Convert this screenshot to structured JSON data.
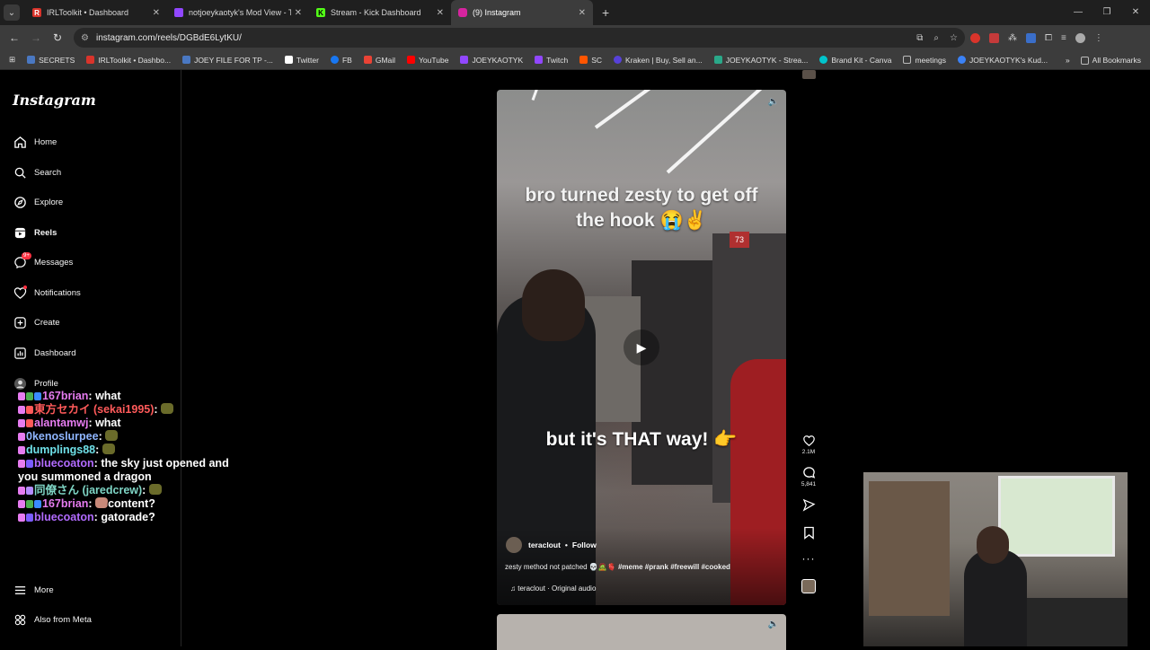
{
  "browser": {
    "tabs": [
      {
        "title": "IRLToolkit • Dashboard",
        "color": "#d9342b",
        "glyph": "R"
      },
      {
        "title": "notjoeykaotyk's Mod View - Tw",
        "color": "#9147ff",
        "glyph": ""
      },
      {
        "title": "Stream - Kick Dashboard",
        "color": "#53fc18",
        "glyph": "K"
      },
      {
        "title": "(9) Instagram",
        "color": "#d6249f",
        "glyph": ""
      }
    ],
    "url": "instagram.com/reels/DGBdE6LytKU/",
    "bookmarks": [
      {
        "label": "SECRETS",
        "color": "#4a78c2"
      },
      {
        "label": "IRLToolkit • Dashbo...",
        "color": "#d9342b"
      },
      {
        "label": "JOEY FILE FOR TP -...",
        "color": "#4a78c2"
      },
      {
        "label": "Twitter",
        "color": "#ffffff"
      },
      {
        "label": "FB",
        "color": "#1877f2"
      },
      {
        "label": "GMail",
        "color": "#ea4335"
      },
      {
        "label": "YouTube",
        "color": "#ff0000"
      },
      {
        "label": "JOEYKAOTYK",
        "color": "#9147ff"
      },
      {
        "label": "Twitch",
        "color": "#9147ff"
      },
      {
        "label": "SC",
        "color": "#ff5500"
      },
      {
        "label": "Kraken | Buy, Sell an...",
        "color": "#5741d9"
      },
      {
        "label": "JOEYKAOTYK - Strea...",
        "color": "#2aa889"
      },
      {
        "label": "Brand Kit - Canva",
        "color": "#00c4cc"
      },
      {
        "label": "meetings",
        "color": "#888888"
      },
      {
        "label": "JOEYKAOTYK's Kud...",
        "color": "#3b82f6"
      }
    ],
    "all_bookmarks": "All Bookmarks"
  },
  "sidebar": {
    "logo": "Instagram",
    "items": [
      {
        "label": "Home",
        "icon": "home-icon"
      },
      {
        "label": "Search",
        "icon": "search-icon"
      },
      {
        "label": "Explore",
        "icon": "compass-icon"
      },
      {
        "label": "Reels",
        "icon": "reels-icon"
      },
      {
        "label": "Messages",
        "icon": "messenger-icon",
        "badge": "9+"
      },
      {
        "label": "Notifications",
        "icon": "heart-icon"
      },
      {
        "label": "Create",
        "icon": "plus-square-icon"
      },
      {
        "label": "Dashboard",
        "icon": "chart-icon"
      },
      {
        "label": "Profile",
        "icon": "avatar-icon"
      }
    ],
    "more": "More",
    "also_from_meta": "Also from Meta"
  },
  "chat": [
    {
      "user": "167brian",
      "cls": "u-pink",
      "msg": "what",
      "emote": false
    },
    {
      "user": "東方セカイ (sekai1995)",
      "cls": "u-red",
      "msg": "",
      "emote": true
    },
    {
      "user": "alantamwj",
      "cls": "u-pink",
      "msg": "what",
      "emote": false
    },
    {
      "user": "0kenoslurpee",
      "cls": "u-blue",
      "msg": "",
      "emote": true
    },
    {
      "user": "dumplings88",
      "cls": "u-cyan",
      "msg": "",
      "emote": true
    },
    {
      "user": "bluecoaton",
      "cls": "u-purple",
      "msg": "the sky just opened and",
      "emote": false
    },
    {
      "user": "",
      "cls": "",
      "msg": "you summoned a dragon",
      "emote": false
    },
    {
      "user": "同僚さん (jaredcrew)",
      "cls": "u-teal",
      "msg": "",
      "emote": true
    },
    {
      "user": "167brian",
      "cls": "u-pink",
      "msg": "content?",
      "emote": false
    },
    {
      "user": "bluecoaton",
      "cls": "u-purple",
      "msg": "gatorade?",
      "emote": false
    }
  ],
  "reel": {
    "caption_top_1": "bro turned zesty to get off",
    "caption_top_2": "the hook 😭✌",
    "caption_mid": "but it's THAT way! 👉",
    "shelf_number": "73",
    "author": "teraclout",
    "follow": "Follow",
    "description_text": "zesty method not patched 💀🧟🫀",
    "hashtags": "#meme #prank #freewill #cooked",
    "audio": "teraclout · Original audio",
    "likes": "2.1M",
    "comments": "5,841"
  }
}
